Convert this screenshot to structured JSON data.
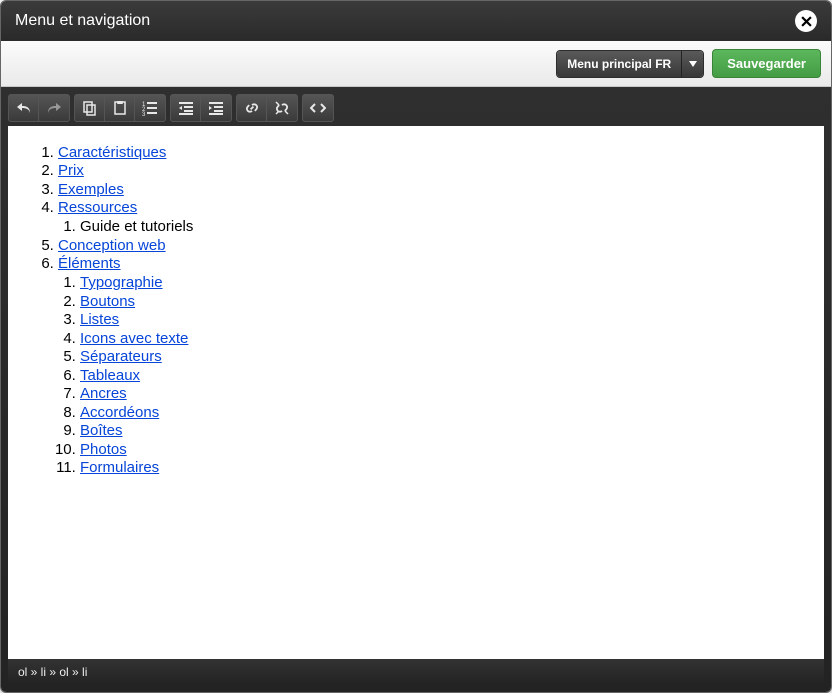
{
  "header": {
    "title": "Menu et navigation"
  },
  "subheader": {
    "dropdown_label": "Menu principal FR",
    "save_label": "Sauvegarder"
  },
  "menu": [
    {
      "label": "Caractéristiques",
      "link": true
    },
    {
      "label": "Prix",
      "link": true
    },
    {
      "label": "Exemples",
      "link": true
    },
    {
      "label": "Ressources",
      "link": true,
      "children": [
        {
          "label": "Guide et tutoriels",
          "link": false
        }
      ]
    },
    {
      "label": "Conception web",
      "link": true
    },
    {
      "label": "Éléments",
      "link": true,
      "children": [
        {
          "label": "Typographie",
          "link": true
        },
        {
          "label": "Boutons",
          "link": true
        },
        {
          "label": "Listes",
          "link": true
        },
        {
          "label": "Icons avec texte",
          "link": true
        },
        {
          "label": "Séparateurs",
          "link": true
        },
        {
          "label": "Tableaux",
          "link": true
        },
        {
          "label": "Ancres",
          "link": true
        },
        {
          "label": "Accordéons",
          "link": true
        },
        {
          "label": "Boîtes",
          "link": true
        },
        {
          "label": "Photos",
          "link": true
        },
        {
          "label": "Formulaires",
          "link": true
        }
      ]
    }
  ],
  "status": "ol » li » ol » li"
}
